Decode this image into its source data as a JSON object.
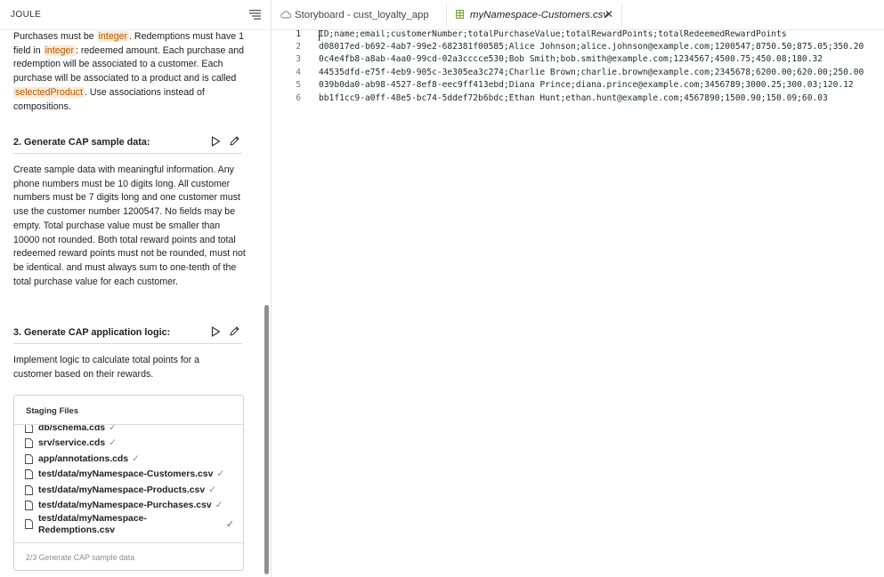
{
  "joule": {
    "title": "JOULE",
    "intro": [
      {
        "t": "Purchases must be "
      },
      {
        "t": "integer",
        "hl": true
      },
      {
        "t": ". Redemptions must have 1 field in "
      },
      {
        "t": "integer",
        "hl": true
      },
      {
        "t": ": redeemed amount. Each purchase and redemption will be associated to a customer. Each purchase will be associated to a product and is called "
      },
      {
        "t": "selectedProduct",
        "hl": true
      },
      {
        "t": ". Use associations instead of compositions."
      }
    ],
    "step2": {
      "title": "2. Generate CAP sample data:",
      "text": "Create sample data with meaningful information. Any phone numbers must be 10 digits long. All customer numbers must be 7 digits long and one customer must use the customer number 1200547. No fields may be empty. Total purchase value must be smaller than 10000 not rounded. Both total reward points and total redeemed reward points must not be rounded, must not be identical. and must always sum to one-tenth of the total purchase value for each customer."
    },
    "step3": {
      "title": "3. Generate CAP application logic:",
      "text": "Implement logic to calculate total points for a customer based on their rewards."
    },
    "staging": {
      "title": "Staging Files",
      "files": [
        {
          "name": "db/schema.cds",
          "check": "✓"
        },
        {
          "name": "srv/service.cds",
          "check": "✓"
        },
        {
          "name": "app/annotations.cds",
          "check": "✓"
        },
        {
          "name": "test/data/myNamespace-Customers.csv",
          "check": "✓"
        },
        {
          "name": "test/data/myNamespace-Products.csv",
          "check": "✓"
        },
        {
          "name": "test/data/myNamespace-Purchases.csv",
          "check": "✓"
        },
        {
          "name": "test/data/myNamespace-Redemptions.csv",
          "check": "✓"
        }
      ],
      "status": "2/3 Generate CAP sample data"
    }
  },
  "tabs": [
    {
      "label": "Storyboard - cust_loyalty_app",
      "icon": "cloud-icon"
    },
    {
      "label": "myNamespace-Customers.csv",
      "icon": "table-file-icon",
      "close": "✕"
    }
  ],
  "editor": {
    "lines": [
      "ID;name;email;customerNumber;totalPurchaseValue;totalRewardPoints;totalRedeemedRewardPoints",
      "d08017ed-b692-4ab7-99e2-682381f00585;Alice Johnson;alice.johnson@example.com;1200547;8750.50;875.05;350.20",
      "0c4e4fb8-a8ab-4aa0-99cd-02a3cccce530;Bob Smith;bob.smith@example.com;1234567;4500.75;450.08;180.32",
      "44535dfd-e75f-4eb9-905c-3e305ea3c274;Charlie Brown;charlie.brown@example.com;2345678;6200.00;620.00;250.00",
      "039b0da0-ab98-4527-8ef8-eec9ff413ebd;Diana Prince;diana.prince@example.com;3456789;3000.25;300.03;120.12",
      "bb1f1cc9-a0ff-48e5-bc74-5ddef72b6bdc;Ethan Hunt;ethan.hunt@example.com;4567890;1500.90;150.09;60.03"
    ],
    "line_numbers": [
      "1",
      "2",
      "3",
      "4",
      "5",
      "6"
    ]
  }
}
